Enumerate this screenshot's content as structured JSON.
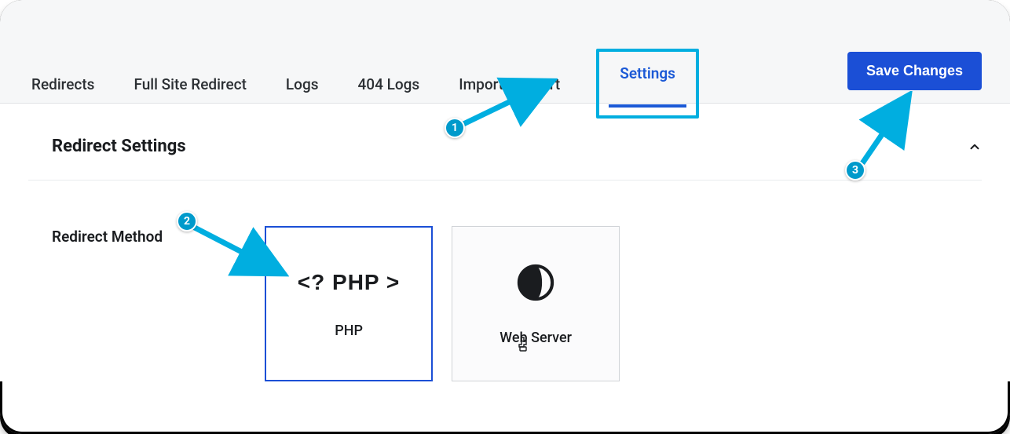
{
  "tabs": {
    "redirects": "Redirects",
    "full_site_redirect": "Full Site Redirect",
    "logs": "Logs",
    "logs_404": "404 Logs",
    "import_export": "Import / Export",
    "settings": "Settings"
  },
  "active_tab": "Settings",
  "save_button": "Save Changes",
  "panel": {
    "title": "Redirect Settings",
    "row_label": "Redirect Method",
    "methods": {
      "php": {
        "icon_text": "<? PHP >",
        "label": "PHP"
      },
      "web_server": {
        "label": "Web Server"
      }
    }
  },
  "callouts": {
    "one": "1",
    "two": "2",
    "three": "3"
  },
  "colors": {
    "accent_blue": "#1b4fd6",
    "callout_teal": "#009acb",
    "highlight_border": "#00aee0"
  }
}
